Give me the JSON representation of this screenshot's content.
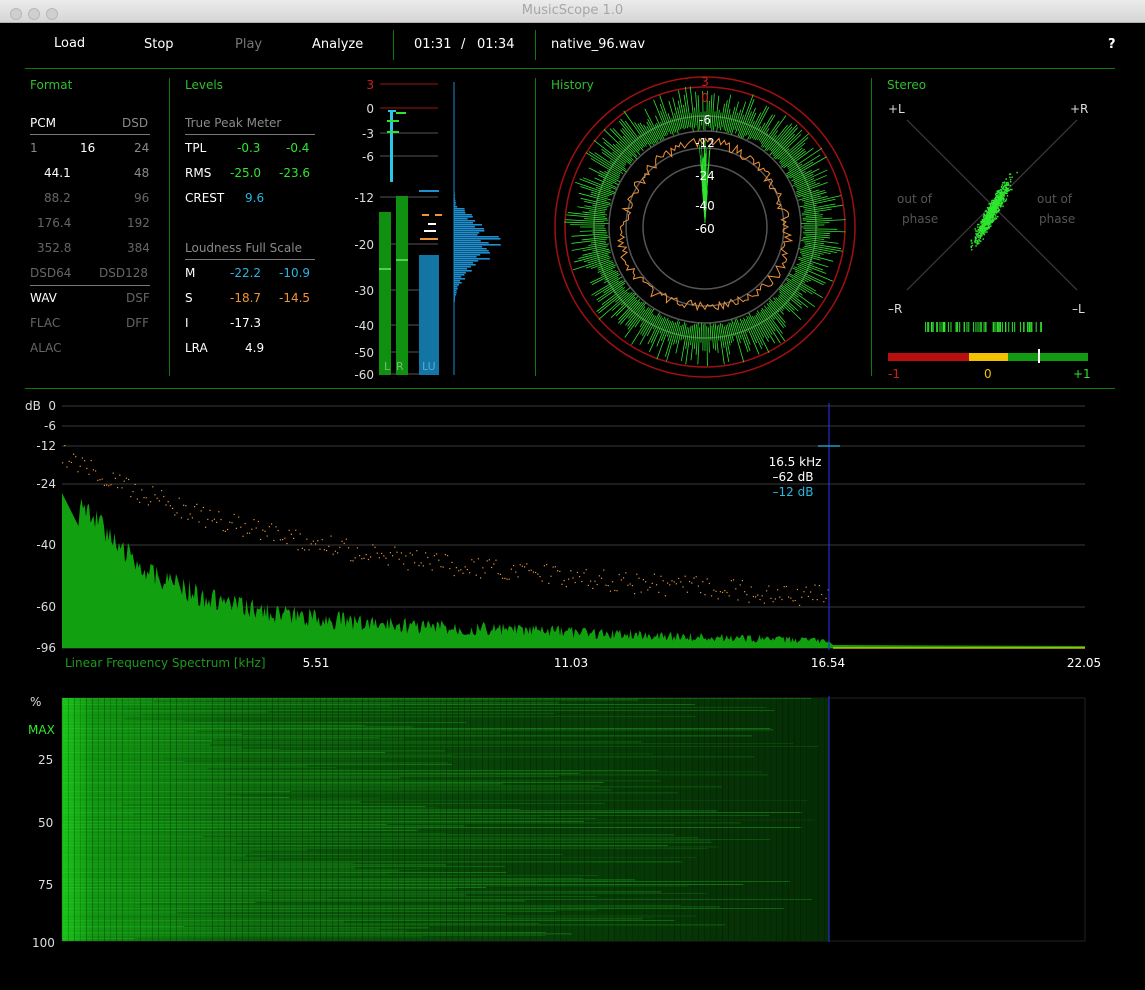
{
  "window": {
    "title": "MusicScope 1.0"
  },
  "toolbar": {
    "load": "Load",
    "stop": "Stop",
    "play": "Play",
    "analyze": "Analyze",
    "time_current": "01:31",
    "time_sep": "/",
    "time_total": "01:34",
    "filename": "native_96.wav",
    "help": "?"
  },
  "format": {
    "title": "Format",
    "header_left": "PCM",
    "header_right": "DSD",
    "bits": [
      "1",
      "16",
      "24"
    ],
    "rates": [
      [
        "44.1",
        "48"
      ],
      [
        "88.2",
        "96"
      ],
      [
        "176.4",
        "192"
      ],
      [
        "352.8",
        "384"
      ]
    ],
    "dsd": [
      "DSD64",
      "DSD128"
    ],
    "containers": [
      [
        "WAV",
        "DSF"
      ],
      [
        "FLAC",
        "DFF"
      ],
      [
        "ALAC",
        ""
      ]
    ]
  },
  "levels": {
    "title": "Levels",
    "tpm_title": "True Peak Meter",
    "tpl_label": "TPL",
    "tpl_l": "-0.3",
    "tpl_r": "-0.4",
    "rms_label": "RMS",
    "rms_l": "-25.0",
    "rms_r": "-23.6",
    "crest_label": "CREST",
    "crest_val": "9.6",
    "lfs_title": "Loudness Full Scale",
    "m_label": "M",
    "m_val": "-22.2",
    "m_max": "-10.9",
    "s_label": "S",
    "s_val": "-18.7",
    "s_max": "-14.5",
    "i_label": "I",
    "i_val": "-17.3",
    "lra_label": "LRA",
    "lra_val": "4.9",
    "meter_scale": [
      "3",
      "0",
      "-3",
      "-6",
      "-12",
      "-20",
      "-30",
      "-40",
      "-50",
      "-60"
    ],
    "meter_labels": [
      "L",
      "R",
      "LU"
    ],
    "meter_values_db": {
      "L_rms": -25.0,
      "R_rms": -23.6,
      "L_peak": -0.3,
      "R_peak": -0.4,
      "LU": -22.2
    }
  },
  "history": {
    "title": "History",
    "rings": [
      "3",
      "0",
      "-6",
      "-12",
      "-24",
      "-40",
      "-60"
    ]
  },
  "stereo": {
    "title": "Stereo",
    "plus_l": "+L",
    "plus_r": "+R",
    "minus_r": "–R",
    "minus_l": "–L",
    "out_of_phase": "out of\nphase",
    "out_of_phase_l1": "out of",
    "out_of_phase_l2": "phase",
    "correlation_labels": [
      "-1",
      "0",
      "+1"
    ],
    "correlation_value": 0.5
  },
  "spectrum": {
    "ylabel": "dB",
    "yticks": [
      "0",
      "-6",
      "-12",
      "-24",
      "-40",
      "-60",
      "-96"
    ],
    "xlabel": "Linear Frequency Spectrum [kHz]",
    "xticks": [
      "5.51",
      "11.03",
      "16.54",
      "22.05"
    ],
    "cursor_freq": "16.5 kHz",
    "cursor_db": "–62 dB",
    "cursor_peak": "–12 dB",
    "cutoff_khz": 16.54
  },
  "spectrogram": {
    "yticks": [
      "%",
      "MAX",
      "25",
      "50",
      "75",
      "100"
    ]
  },
  "colors": {
    "accent_green": "#2fbf2f",
    "cyan": "#29b6e0",
    "orange": "#f0943a",
    "red": "#c01010",
    "blue_cursor": "#2030d0"
  }
}
